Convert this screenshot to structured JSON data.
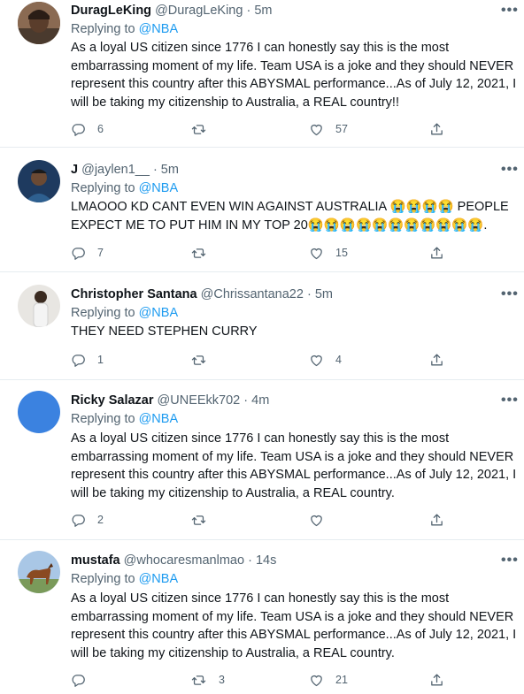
{
  "icons": {
    "reply": "reply-icon",
    "retweet": "retweet-icon",
    "like": "like-icon",
    "share": "share-icon",
    "more": "more-icon",
    "crying_emoji": "loudly-crying-face-emoji"
  },
  "colors": {
    "accent": "#1d9bf0",
    "muted": "#536471",
    "text": "#0f1419",
    "avatar_ricky": "#3b82e0"
  },
  "more_label": "•••",
  "tweets": [
    {
      "name": "DuragLeKing",
      "handle": "@DuragLeKing",
      "time": "· 5m",
      "replying_prefix": "Replying to ",
      "replying_to": "@NBA",
      "text": "As a loyal US citizen since 1776 I can honestly say this is the most embarrassing moment of my life. Team USA is a joke and they should NEVER represent this country after this ABYSMAL performance...As of July 12, 2021, I will be taking my citizenship to Australia, a REAL country!!",
      "replies": "6",
      "retweets": "",
      "likes": "57"
    },
    {
      "name": "J",
      "handle": "@jaylen1__",
      "time": "· 5m",
      "replying_prefix": "Replying to ",
      "replying_to": "@NBA",
      "text_line1": "LMAOOO KD CANT EVEN WIN AGAINST AUSTRALIA 😭😭😭😭 PEOPLE",
      "text_line2": "EXPECT ME TO PUT HIM IN MY TOP 20😭😭😭😭😭😭😭😭😭😭😭.",
      "replies": "7",
      "retweets": "",
      "likes": "15"
    },
    {
      "name": "Christopher Santana",
      "handle": "@Chrissantana22",
      "time": "· 5m",
      "replying_prefix": "Replying to ",
      "replying_to": "@NBA",
      "text": "THEY NEED STEPHEN CURRY",
      "replies": "1",
      "retweets": "",
      "likes": "4"
    },
    {
      "name": "Ricky Salazar",
      "handle": "@UNEEkk702",
      "time": "· 4m",
      "replying_prefix": "Replying to ",
      "replying_to": "@NBA",
      "text": "As a loyal US citizen since 1776 I can honestly say this is the most embarrassing moment of my life. Team USA is a joke and they should NEVER represent this country after this ABYSMAL performance...As of July 12, 2021, I will be taking my citizenship to Australia, a REAL country.",
      "replies": "2",
      "retweets": "",
      "likes": ""
    },
    {
      "name": "mustafa",
      "handle": "@whocaresmanlmao",
      "time": "· 14s",
      "replying_prefix": "Replying to ",
      "replying_to": "@NBA",
      "text": "As a loyal US citizen since 1776 I can honestly say this is the most embarrassing moment of my life. Team USA is a joke and they should NEVER represent this country after this ABYSMAL performance...As of July 12, 2021, I will be taking my citizenship to Australia, a REAL country.",
      "replies": "",
      "retweets": "3",
      "likes": "21"
    }
  ]
}
